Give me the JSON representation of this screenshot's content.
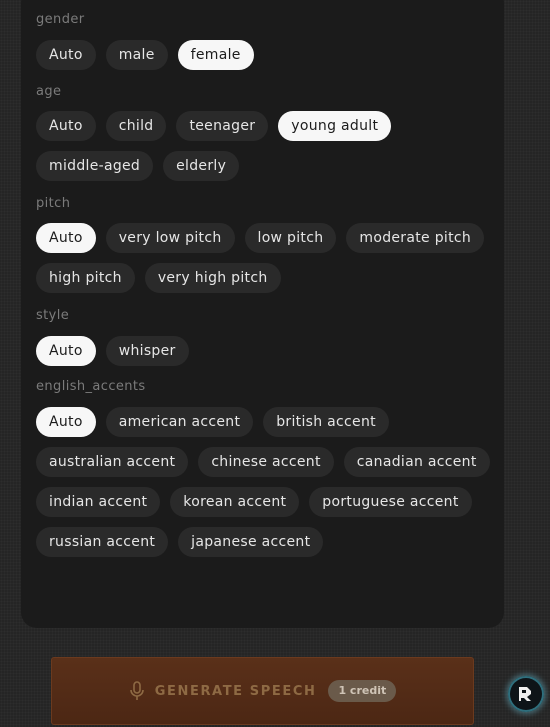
{
  "sections": [
    {
      "key": "gender",
      "label": "gender",
      "options": [
        "Auto",
        "male",
        "female"
      ],
      "selected": "female"
    },
    {
      "key": "age",
      "label": "age",
      "options": [
        "Auto",
        "child",
        "teenager",
        "young adult",
        "middle-aged",
        "elderly"
      ],
      "selected": "young adult"
    },
    {
      "key": "pitch",
      "label": "pitch",
      "options": [
        "Auto",
        "very low pitch",
        "low pitch",
        "moderate pitch",
        "high pitch",
        "very high pitch"
      ],
      "selected": "Auto"
    },
    {
      "key": "style",
      "label": "style",
      "options": [
        "Auto",
        "whisper"
      ],
      "selected": "Auto"
    },
    {
      "key": "english_accents",
      "label": "english_accents",
      "options": [
        "Auto",
        "american accent",
        "british accent",
        "australian accent",
        "chinese accent",
        "canadian accent",
        "indian accent",
        "korean accent",
        "portuguese accent",
        "russian accent",
        "japanese accent"
      ],
      "selected": "Auto"
    }
  ],
  "generate": {
    "label": "GENERATE SPEECH",
    "credit": "1 credit",
    "icon": "microphone-icon"
  },
  "floating_widget": {
    "icon": "app-logo-icon"
  },
  "colors": {
    "panel_bg": "#1b1b1b",
    "chip_bg": "#2a2a2a",
    "chip_selected_bg": "#f7f7f7",
    "generate_bg": "#52291a",
    "generate_text": "#8e6a44"
  }
}
